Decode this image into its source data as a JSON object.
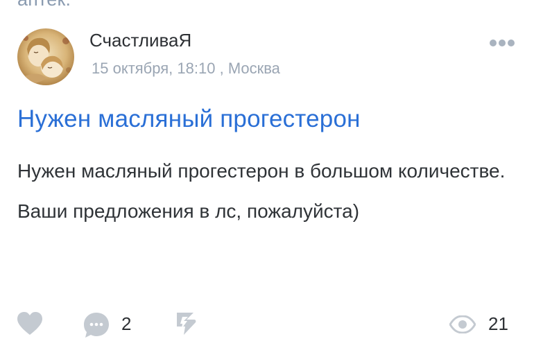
{
  "previous_post": {
    "text_fragment": "аптек."
  },
  "post": {
    "author": {
      "name": "СчастливаЯ"
    },
    "meta": {
      "date": "15 октября, 18:10",
      "separator": " , ",
      "city": "Москва"
    },
    "title": "Нужен масляный прогестерон",
    "body": [
      "Нужен масляный прогестерон в большом количестве.",
      "Ваши предложения в лс, пожалуйста)"
    ]
  },
  "actions": {
    "comments_count": "2",
    "views_count": "21"
  },
  "icons": {
    "more": "more-dots-icon",
    "like": "heart-icon",
    "comment": "comment-bubble-icon",
    "repost": "repost-icon",
    "views": "eye-icon"
  },
  "colors": {
    "title": "#2a6fd6",
    "icon_gray": "#c4cad1",
    "meta_gray": "#9aa5b3",
    "text": "#2f3337"
  }
}
